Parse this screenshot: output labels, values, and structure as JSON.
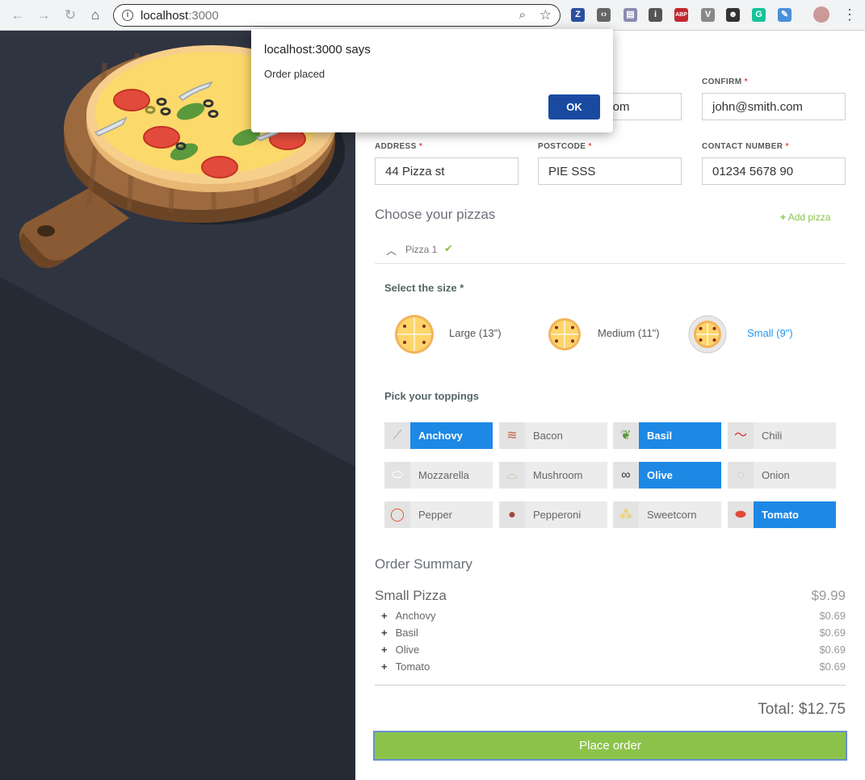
{
  "browser": {
    "url_host": "localhost",
    "url_port": ":3000",
    "extensions": [
      {
        "name": "zotero-icon",
        "text": "Z",
        "color": "#2b4ea0"
      },
      {
        "name": "code-icon",
        "text": "‹›",
        "color": "#666666"
      },
      {
        "name": "page-icon",
        "text": "▤",
        "color": "#8a8ab0"
      },
      {
        "name": "info-circle-icon",
        "text": "i",
        "color": "#555555"
      },
      {
        "name": "adblock-icon",
        "text": "ABP",
        "color": "#c0282d"
      },
      {
        "name": "vue-icon",
        "text": "V",
        "color": "#888888"
      },
      {
        "name": "spy-icon",
        "text": "☻",
        "color": "#333333"
      },
      {
        "name": "grammarly-icon",
        "text": "G",
        "color": "#15c39a"
      },
      {
        "name": "feather-icon",
        "text": "✎",
        "color": "#4a90d9"
      }
    ]
  },
  "dialog": {
    "title": "localhost:3000 says",
    "message": "Order placed",
    "ok_label": "OK"
  },
  "form": {
    "email_value_partial": ".com",
    "confirm_label": "CONFIRM",
    "confirm_value": "john@smith.com",
    "address_label": "ADDRESS",
    "address_value": "44 Pizza st",
    "postcode_label": "POSTCODE",
    "postcode_value": "PIE SSS",
    "contact_label": "CONTACT NUMBER",
    "contact_value": "01234 5678 90",
    "required_mark": "*"
  },
  "pizzas": {
    "title": "Choose your pizzas",
    "add_label": "Add pizza",
    "tab_label": "Pizza 1",
    "size_title": "Select the size *",
    "sizes": [
      {
        "label": "Large (13\")",
        "active": false
      },
      {
        "label": "Medium (11\")",
        "active": false
      },
      {
        "label": "Small (9\")",
        "active": true
      }
    ],
    "toppings_title": "Pick your toppings",
    "toppings": [
      {
        "label": "Anchovy",
        "selected": true,
        "icon": "anchovy-icon"
      },
      {
        "label": "Bacon",
        "selected": false,
        "icon": "bacon-icon"
      },
      {
        "label": "Basil",
        "selected": true,
        "icon": "basil-icon"
      },
      {
        "label": "Chili",
        "selected": false,
        "icon": "chili-icon"
      },
      {
        "label": "Mozzarella",
        "selected": false,
        "icon": "mozzarella-icon"
      },
      {
        "label": "Mushroom",
        "selected": false,
        "icon": "mushroom-icon"
      },
      {
        "label": "Olive",
        "selected": true,
        "icon": "olive-icon"
      },
      {
        "label": "Onion",
        "selected": false,
        "icon": "onion-icon"
      },
      {
        "label": "Pepper",
        "selected": false,
        "icon": "pepper-icon"
      },
      {
        "label": "Pepperoni",
        "selected": false,
        "icon": "pepperoni-icon"
      },
      {
        "label": "Sweetcorn",
        "selected": false,
        "icon": "sweetcorn-icon"
      },
      {
        "label": "Tomato",
        "selected": true,
        "icon": "tomato-icon"
      }
    ]
  },
  "summary": {
    "title": "Order Summary",
    "item_label": "Small Pizza",
    "item_price": "$9.99",
    "extras": [
      {
        "label": "Anchovy",
        "price": "$0.69"
      },
      {
        "label": "Basil",
        "price": "$0.69"
      },
      {
        "label": "Olive",
        "price": "$0.69"
      },
      {
        "label": "Tomato",
        "price": "$0.69"
      }
    ],
    "total": "Total: $12.75",
    "place_order_label": "Place order"
  },
  "colors": {
    "accent_blue": "#1e88e5",
    "green": "#8bc34a",
    "dialog_button": "#1a4aa0",
    "panel_dark": "#2a2f3a"
  }
}
